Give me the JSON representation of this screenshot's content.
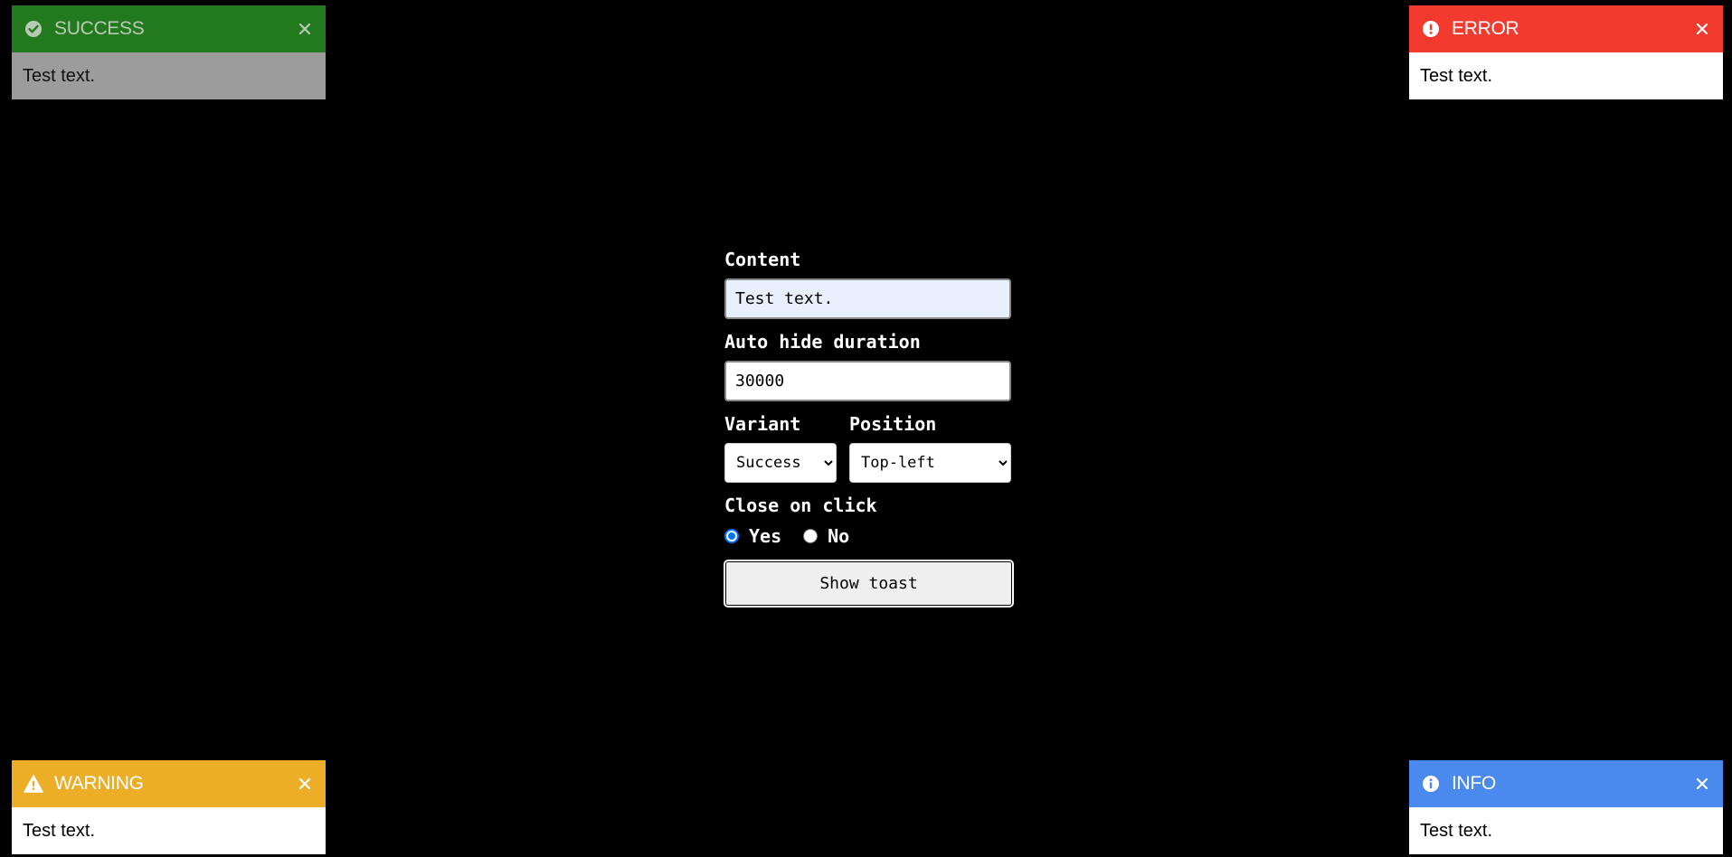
{
  "toasts": {
    "success": {
      "title": "SUCCESS",
      "message": "Test text.",
      "icon": "check-circle-icon",
      "color": "#237a1e"
    },
    "error": {
      "title": "ERROR",
      "message": "Test text.",
      "icon": "exclamation-circle-icon",
      "color": "#f23a2f"
    },
    "warning": {
      "title": "WARNING",
      "message": "Test text.",
      "icon": "warning-triangle-icon",
      "color": "#edae27"
    },
    "info": {
      "title": "INFO",
      "message": "Test text.",
      "icon": "info-circle-icon",
      "color": "#4a89ee"
    }
  },
  "form": {
    "content_label": "Content",
    "content_value": "Test text.",
    "duration_label": "Auto hide duration",
    "duration_value": "30000",
    "variant_label": "Variant",
    "variant_selected": "Success",
    "position_label": "Position",
    "position_selected": "Top-left",
    "close_label": "Close on click",
    "radio_yes": "Yes",
    "radio_no": "No",
    "close_on_click": "Yes",
    "show_button": "Show toast"
  }
}
